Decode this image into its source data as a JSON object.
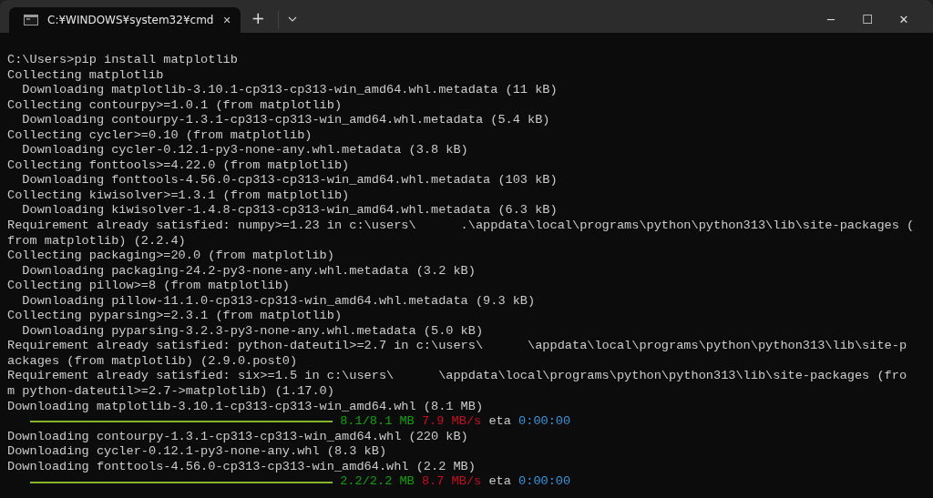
{
  "tab": {
    "title": "C:¥WINDOWS¥system32¥cmd",
    "selected": true,
    "close": "✕"
  },
  "new_tab": "+",
  "window_controls": {
    "minimize": "─",
    "maximize": "☐",
    "close": "✕"
  },
  "lines": [
    {
      "kind": "text",
      "text": "C:\\Users>pip install matplotlib"
    },
    {
      "kind": "text",
      "text": "Collecting matplotlib"
    },
    {
      "kind": "text",
      "text": "  Downloading matplotlib-3.10.1-cp313-cp313-win_amd64.whl.metadata (11 kB)"
    },
    {
      "kind": "text",
      "text": "Collecting contourpy>=1.0.1 (from matplotlib)"
    },
    {
      "kind": "text",
      "text": "  Downloading contourpy-1.3.1-cp313-cp313-win_amd64.whl.metadata (5.4 kB)"
    },
    {
      "kind": "text",
      "text": "Collecting cycler>=0.10 (from matplotlib)"
    },
    {
      "kind": "text",
      "text": "  Downloading cycler-0.12.1-py3-none-any.whl.metadata (3.8 kB)"
    },
    {
      "kind": "text",
      "text": "Collecting fonttools>=4.22.0 (from matplotlib)"
    },
    {
      "kind": "text",
      "text": "  Downloading fonttools-4.56.0-cp313-cp313-win_amd64.whl.metadata (103 kB)"
    },
    {
      "kind": "text",
      "text": "Collecting kiwisolver>=1.3.1 (from matplotlib)"
    },
    {
      "kind": "text",
      "text": "  Downloading kiwisolver-1.4.8-cp313-cp313-win_amd64.whl.metadata (6.3 kB)"
    },
    {
      "kind": "text",
      "text": "Requirement already satisfied: numpy>=1.23 in c:\\users\\      .\\appdata\\local\\programs\\python\\python313\\lib\\site-packages ("
    },
    {
      "kind": "text",
      "text": "from matplotlib) (2.2.4)"
    },
    {
      "kind": "text",
      "text": "Collecting packaging>=20.0 (from matplotlib)"
    },
    {
      "kind": "text",
      "text": "  Downloading packaging-24.2-py3-none-any.whl.metadata (3.2 kB)"
    },
    {
      "kind": "text",
      "text": "Collecting pillow>=8 (from matplotlib)"
    },
    {
      "kind": "text",
      "text": "  Downloading pillow-11.1.0-cp313-cp313-win_amd64.whl.metadata (9.3 kB)"
    },
    {
      "kind": "text",
      "text": "Collecting pyparsing>=2.3.1 (from matplotlib)"
    },
    {
      "kind": "text",
      "text": "  Downloading pyparsing-3.2.3-py3-none-any.whl.metadata (5.0 kB)"
    },
    {
      "kind": "text",
      "text": "Requirement already satisfied: python-dateutil>=2.7 in c:\\users\\      \\appdata\\local\\programs\\python\\python313\\lib\\site-p"
    },
    {
      "kind": "text",
      "text": "ackages (from matplotlib) (2.9.0.post0)"
    },
    {
      "kind": "text",
      "text": "Requirement already satisfied: six>=1.5 in c:\\users\\      \\appdata\\local\\programs\\python\\python313\\lib\\site-packages (fro"
    },
    {
      "kind": "text",
      "text": "m python-dateutil>=2.7->matplotlib) (1.17.0)"
    },
    {
      "kind": "text",
      "text": "Downloading matplotlib-3.10.1-cp313-cp313-win_amd64.whl (8.1 MB)"
    },
    {
      "kind": "progress",
      "level": 1,
      "amount": "8.1/8.1 MB",
      "speed": "7.9 MB/s",
      "eta_label": "eta",
      "eta": "0:00:00"
    },
    {
      "kind": "text",
      "text": "Downloading contourpy-1.3.1-cp313-cp313-win_amd64.whl (220 kB)"
    },
    {
      "kind": "text",
      "text": "Downloading cycler-0.12.1-py3-none-any.whl (8.3 kB)"
    },
    {
      "kind": "text",
      "text": "Downloading fonttools-4.56.0-cp313-cp313-win_amd64.whl (2.2 MB)"
    },
    {
      "kind": "progress",
      "level": 1,
      "amount": "2.2/2.2 MB",
      "speed": "8.7 MB/s",
      "eta_label": "eta",
      "eta": "0:00:00"
    }
  ]
}
